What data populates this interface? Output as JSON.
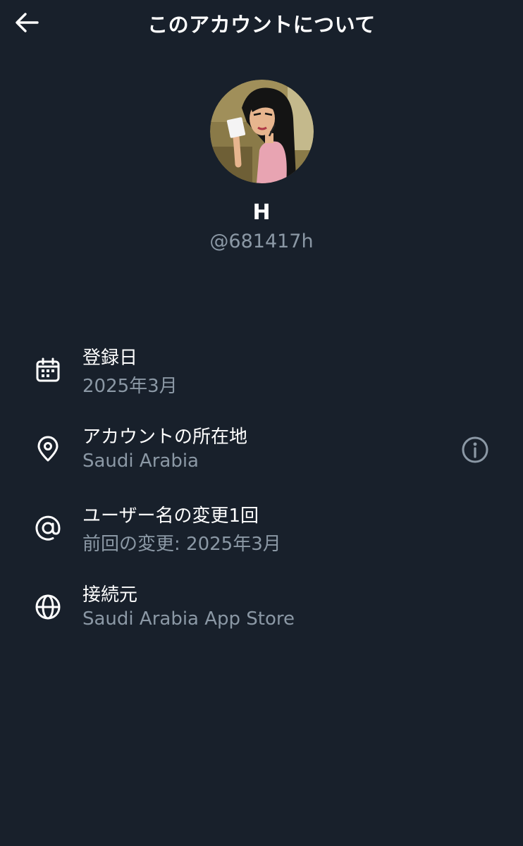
{
  "header": {
    "title": "このアカウントについて",
    "back_icon": "arrow-left-icon"
  },
  "profile": {
    "display_name": "H",
    "handle": "@681417h",
    "avatar": "cartoon-avatar"
  },
  "details": [
    {
      "icon": "calendar-icon",
      "title": "登録日",
      "value": "2025年3月"
    },
    {
      "icon": "location-pin-icon",
      "title": "アカウントの所在地",
      "value": "Saudi Arabia",
      "info_icon": "info-circle-icon"
    },
    {
      "icon": "at-sign-icon",
      "title": "ユーザー名の変更1回",
      "value": "前回の変更: 2025年3月"
    },
    {
      "icon": "globe-icon",
      "title": "接続元",
      "value": "Saudi Arabia App Store"
    }
  ],
  "colors": {
    "background": "#18202b",
    "primary_text": "#ffffff",
    "secondary_text": "#8b98a5"
  }
}
